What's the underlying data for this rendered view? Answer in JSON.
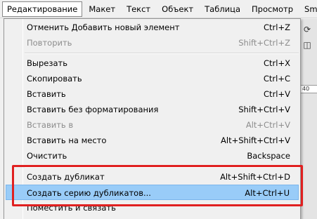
{
  "menubar": {
    "items": [
      {
        "label": "Редактирование"
      },
      {
        "label": "Макет"
      },
      {
        "label": "Текст"
      },
      {
        "label": "Объект"
      },
      {
        "label": "Таблица"
      },
      {
        "label": "Просмотр"
      },
      {
        "label": "Smart G"
      }
    ],
    "active_index": 0
  },
  "menu": {
    "items": [
      {
        "label": "Отменить Добавить новый элемент",
        "shortcut": "Ctrl+Z",
        "enabled": true
      },
      {
        "label": "Повторить",
        "shortcut": "Shift+Ctrl+Z",
        "enabled": false
      },
      {
        "label": "Вырезать",
        "shortcut": "Ctrl+X",
        "enabled": true
      },
      {
        "label": "Скопировать",
        "shortcut": "Ctrl+C",
        "enabled": true
      },
      {
        "label": "Вставить",
        "shortcut": "Ctrl+V",
        "enabled": true
      },
      {
        "label": "Вставить без форматирования",
        "shortcut": "Shift+Ctrl+V",
        "enabled": true
      },
      {
        "label": "Вставить в",
        "shortcut": "Alt+Ctrl+V",
        "enabled": false
      },
      {
        "label": "Вставить на место",
        "shortcut": "Alt+Shift+Ctrl+V",
        "enabled": true
      },
      {
        "label": "Очистить",
        "shortcut": "Backspace",
        "enabled": true
      },
      {
        "label": "Создать дубликат",
        "shortcut": "Alt+Shift+Ctrl+D",
        "enabled": true
      },
      {
        "label": "Создать серию дубликатов...",
        "shortcut": "Alt+Ctrl+U",
        "enabled": true,
        "highlighted": true
      },
      {
        "label": "Поместить и связать",
        "shortcut": "",
        "enabled": true
      }
    ]
  },
  "background": {
    "ruler_text": "40"
  },
  "colors": {
    "highlight": "#99ccf8",
    "annotation": "#e02020",
    "disabled_text": "#8d8d8d"
  }
}
